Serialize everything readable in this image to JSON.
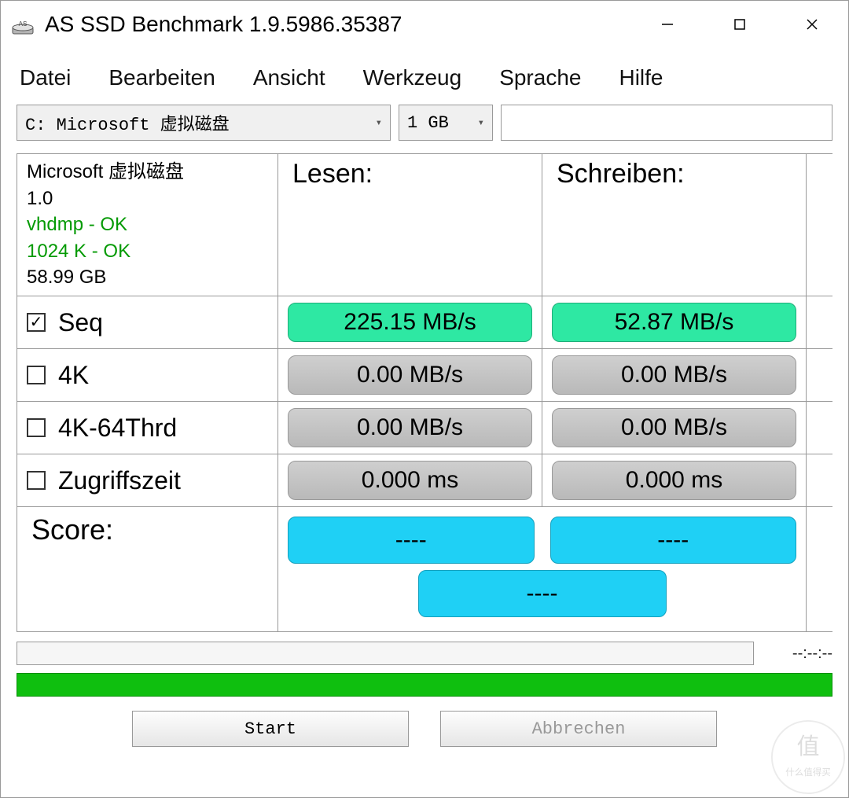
{
  "window": {
    "title": "AS SSD Benchmark 1.9.5986.35387"
  },
  "menu": {
    "file": "Datei",
    "edit": "Bearbeiten",
    "view": "Ansicht",
    "tool": "Werkzeug",
    "lang": "Sprache",
    "help": "Hilfe"
  },
  "selectors": {
    "drive": "C: Microsoft 虚拟磁盘",
    "size": "1 GB"
  },
  "driveinfo": {
    "name": "Microsoft 虚拟磁盘",
    "ver": "1.0",
    "drv": "vhdmp - OK",
    "align": "1024 K - OK",
    "capacity": "58.99 GB"
  },
  "headers": {
    "read": "Lesen:",
    "write": "Schreiben:"
  },
  "tests": {
    "seq": {
      "label": "Seq",
      "checked": true,
      "read": "225.15 MB/s",
      "write": "52.87 MB/s"
    },
    "k4": {
      "label": "4K",
      "checked": false,
      "read": "0.00 MB/s",
      "write": "0.00 MB/s"
    },
    "k464": {
      "label": "4K-64Thrd",
      "checked": false,
      "read": "0.00 MB/s",
      "write": "0.00 MB/s"
    },
    "acc": {
      "label": "Zugriffszeit",
      "checked": false,
      "read": "0.000 ms",
      "write": "0.000 ms"
    }
  },
  "score": {
    "label": "Score:",
    "read": "----",
    "write": "----",
    "total": "----"
  },
  "progress": {
    "time": "--:--:--"
  },
  "buttons": {
    "start": "Start",
    "abort": "Abbrechen"
  },
  "watermark": "值 什么值得买"
}
